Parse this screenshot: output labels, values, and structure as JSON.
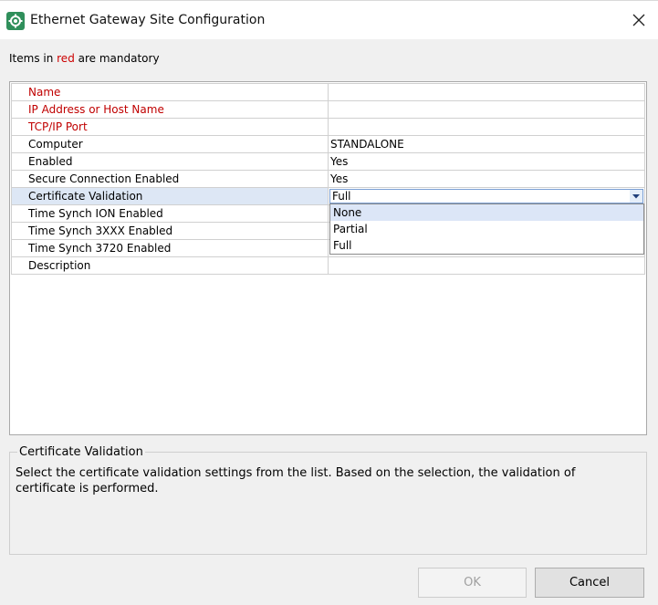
{
  "window": {
    "title": "Ethernet Gateway Site Configuration",
    "icon": "gear-icon",
    "close_icon": "close-icon"
  },
  "notice": {
    "prefix": "Items in ",
    "highlight": "red",
    "suffix": " are mandatory",
    "highlight_color": "#cc0000"
  },
  "properties": [
    {
      "label": "Name",
      "value": "",
      "required": true
    },
    {
      "label": "IP Address or Host Name",
      "value": "",
      "required": true
    },
    {
      "label": "TCP/IP Port",
      "value": "",
      "required": true
    },
    {
      "label": "Computer",
      "value": "STANDALONE",
      "required": false
    },
    {
      "label": "Enabled",
      "value": "Yes",
      "required": false
    },
    {
      "label": "Secure Connection Enabled",
      "value": "Yes",
      "required": false
    },
    {
      "label": "Certificate Validation",
      "value": "Full",
      "required": false,
      "selected": true
    },
    {
      "label": "Time Synch ION Enabled",
      "value": "",
      "required": false
    },
    {
      "label": "Time Synch 3XXX Enabled",
      "value": "",
      "required": false
    },
    {
      "label": "Time Synch 3720 Enabled",
      "value": "",
      "required": false
    },
    {
      "label": "Description",
      "value": "",
      "required": false
    }
  ],
  "dropdown": {
    "options": [
      "None",
      "Partial",
      "Full"
    ],
    "highlighted": "None"
  },
  "info": {
    "title": "Certificate Validation",
    "description": "Select the certificate validation settings from the list. Based on the selection, the validation of certificate is performed."
  },
  "buttons": {
    "ok": "OK",
    "cancel": "Cancel"
  },
  "colors": {
    "required_text": "#c00000",
    "selected_row": "#dde7f5",
    "dropdown_hover": "#dce6f7"
  }
}
